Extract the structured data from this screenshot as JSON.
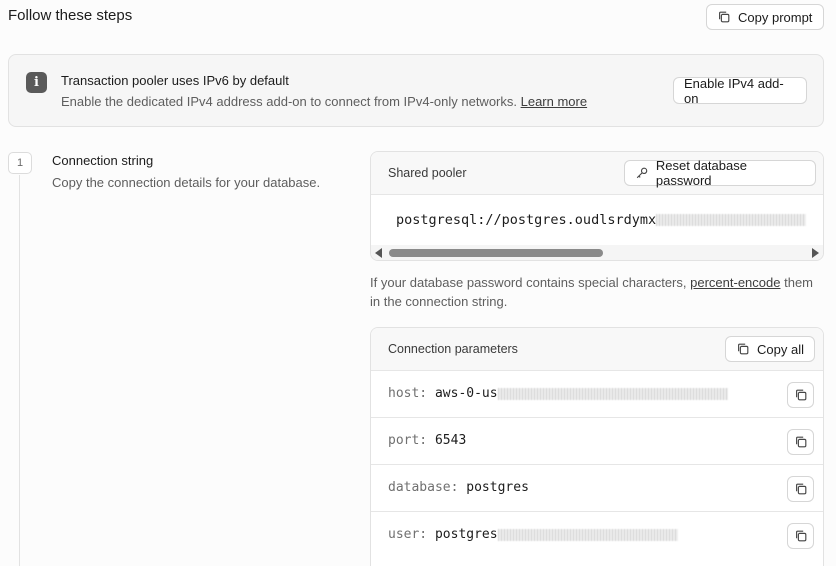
{
  "header": {
    "title": "Follow these steps",
    "copy_prompt_label": "Copy prompt"
  },
  "banner": {
    "title": "Transaction pooler uses IPv6 by default",
    "description": "Enable the dedicated IPv4 address add-on to connect from IPv4-only networks.",
    "learn_more": "Learn more",
    "enable_button": "Enable IPv4 add-on"
  },
  "step": {
    "number": "1",
    "title": "Connection string",
    "description": "Copy the connection details for your database."
  },
  "pooler": {
    "label": "Shared pooler",
    "reset_button": "Reset database password",
    "connection_string": "postgresql://postgres.oudlsrdymx"
  },
  "note": {
    "text_before": "If your database password contains special characters,",
    "link": "percent-encode",
    "text_after": "them in the connection string."
  },
  "params": {
    "label": "Connection parameters",
    "copy_all": "Copy all",
    "rows": [
      {
        "key": "host:",
        "value": "aws-0-us"
      },
      {
        "key": "port:",
        "value": "6543"
      },
      {
        "key": "database:",
        "value": "postgres"
      },
      {
        "key": "user:",
        "value": "postgres"
      }
    ]
  },
  "icons": {
    "copy": "copy-icon",
    "key": "key-icon",
    "info": "info-icon"
  }
}
